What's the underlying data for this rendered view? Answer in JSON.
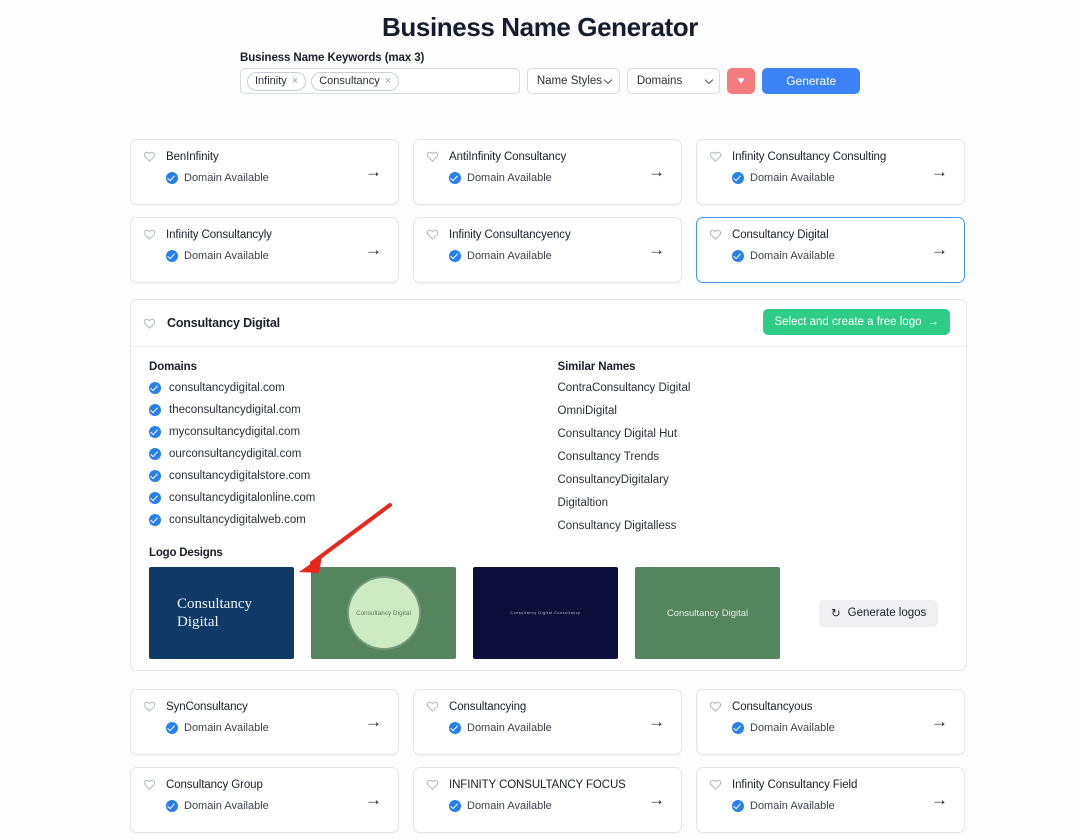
{
  "header": {
    "title": "Business Name Generator"
  },
  "search": {
    "keywords_label": "Business Name Keywords (max 3)",
    "chips": [
      "Infinity",
      "Consultancy"
    ],
    "remove_glyph": "×",
    "name_styles_label": "Name Styles",
    "domains_label": "Domains",
    "favorite_glyph": "♥",
    "generate_label": "Generate"
  },
  "cards_top": [
    {
      "name": "BenInfinity",
      "status": "Domain Available",
      "selected": false
    },
    {
      "name": "AntiInfinity Consultancy",
      "status": "Domain Available",
      "selected": false
    },
    {
      "name": "Infinity Consultancy Consulting",
      "status": "Domain Available",
      "selected": false
    },
    {
      "name": "Infinity Consultancyly",
      "status": "Domain Available",
      "selected": false
    },
    {
      "name": "Infinity Consultancyency",
      "status": "Domain Available",
      "selected": false
    },
    {
      "name": "Consultancy Digital",
      "status": "Domain Available",
      "selected": true
    }
  ],
  "cards_bottom": [
    {
      "name": "SynConsultancy",
      "status": "Domain Available"
    },
    {
      "name": "Consultancying",
      "status": "Domain Available"
    },
    {
      "name": "Consultancyous",
      "status": "Domain Available"
    },
    {
      "name": "Consultancy Group",
      "status": "Domain Available"
    },
    {
      "name": "INFINITY CONSULTANCY FOCUS",
      "status": "Domain Available"
    },
    {
      "name": "Infinity Consultancy Field",
      "status": "Domain Available"
    }
  ],
  "detail": {
    "title": "Consultancy Digital",
    "cta_label": "Select and create a free logo",
    "cta_arrow": "→",
    "domains_heading": "Domains",
    "domains": [
      "consultancydigital.com",
      "theconsultancydigital.com",
      "myconsultancydigital.com",
      "ourconsultancydigital.com",
      "consultancydigitalstore.com",
      "consultancydigitalonline.com",
      "consultancydigitalweb.com"
    ],
    "similar_heading": "Similar Names",
    "similar_names": [
      "ContraConsultancy Digital",
      "OmniDigital",
      "Consultancy Digital Hut",
      "Consultancy Trends",
      "ConsultancyDigitalary",
      "Digitaltion",
      "Consultancy Digitalless"
    ],
    "logos_heading": "Logo Designs",
    "logos": [
      {
        "style": "navy-serif",
        "line1": "Consultancy",
        "line2": "Digital",
        "bg": "#0F3A68"
      },
      {
        "style": "green-circle",
        "text": "Consultancy Digital",
        "bg": "#55855F"
      },
      {
        "style": "dark-tiny",
        "text": "Consultancy Digital Consultancy",
        "bg": "#0B0F3A"
      },
      {
        "style": "green-plain",
        "text": "Consultancy Digital",
        "bg": "#53865F"
      }
    ],
    "generate_logos_label": "Generate logos",
    "refresh_glyph": "↻"
  },
  "colors": {
    "accent_blue": "#3B82F6",
    "favorite_coral": "#F47C7C",
    "cta_green": "#2ECC87",
    "check_blue": "#2680EB",
    "selected_border": "#3B9BF0",
    "annotation_red": "#E8261C"
  },
  "icons": {
    "heart": "heart-outline-icon",
    "check": "check-circle-icon",
    "arrow_right": "→"
  }
}
